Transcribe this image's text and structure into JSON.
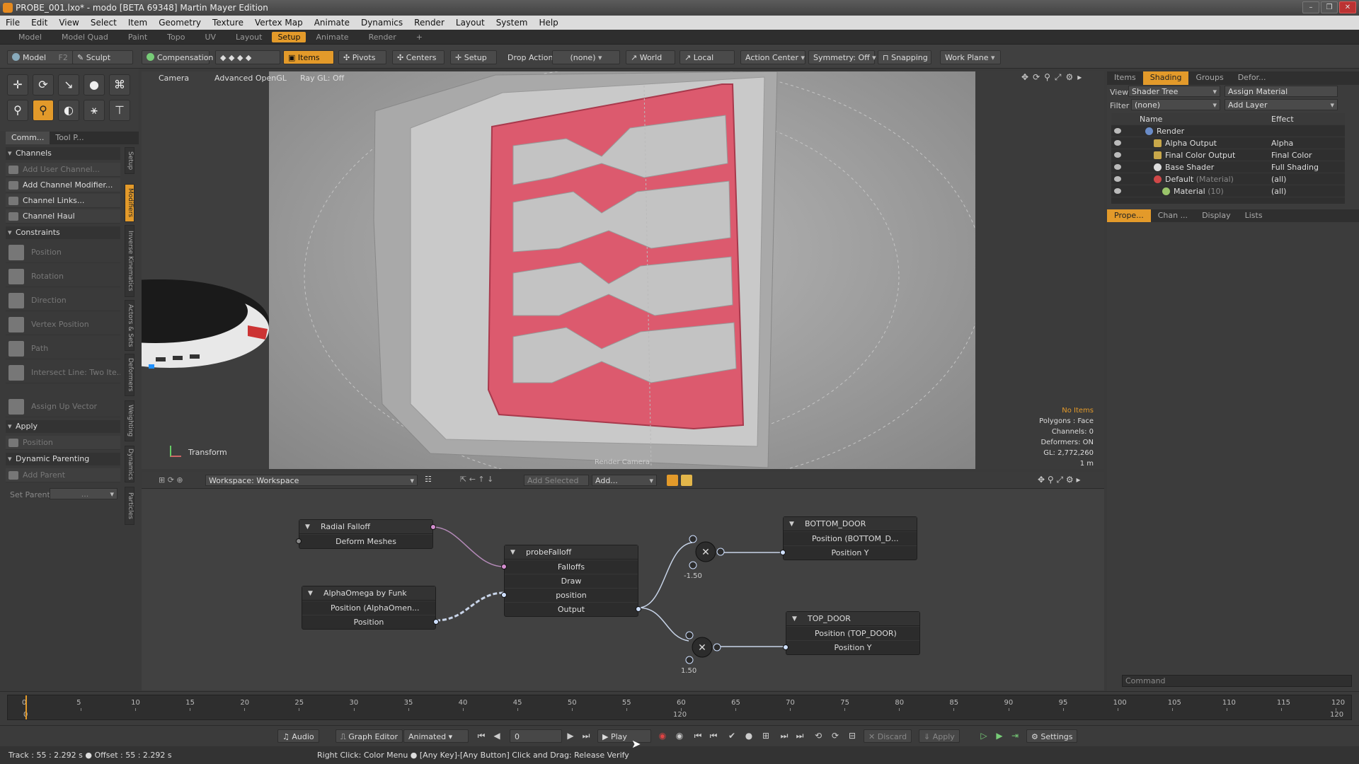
{
  "window": {
    "title": "PROBE_001.lxo* - modo [BETA 69348] Martin Mayer Edition",
    "buttons": [
      "–",
      "❐",
      "✕"
    ]
  },
  "menu": [
    "File",
    "Edit",
    "View",
    "Select",
    "Item",
    "Geometry",
    "Texture",
    "Vertex Map",
    "Animate",
    "Dynamics",
    "Render",
    "Layout",
    "System",
    "Help"
  ],
  "layout_tabs": [
    "Model",
    "Model Quad",
    "Paint",
    "Topo",
    "UV",
    "Layout",
    "Setup",
    "Animate",
    "Render",
    "+"
  ],
  "active_layout_tab": "Setup",
  "toolbar": {
    "model": "Model",
    "model_key": "F2",
    "sculpt": "Sculpt",
    "compensation": "Compensation",
    "items": "Items",
    "pivots": "Pivots",
    "centers": "Centers",
    "setup": "Setup",
    "drop_action_label": "Drop Action",
    "drop_action_value": "(none)",
    "world": "World",
    "local": "Local",
    "action_center": "Action Center",
    "symmetry": "Symmetry: Off",
    "snapping": "Snapping",
    "work_plane": "Work Plane"
  },
  "left_panel": {
    "tabs": [
      "Comm...",
      "Tool P..."
    ],
    "channels_header": "Channels",
    "channel_items": [
      "Add User Channel...",
      "Add Channel Modifier...",
      "Channel Links...",
      "Channel Haul"
    ],
    "constraints_header": "Constraints",
    "constraint_items": [
      "Position",
      "Rotation",
      "Direction",
      "Vertex Position",
      "Path",
      "Intersect Line: Two Ite...",
      "Assign Up Vector"
    ],
    "apply_header": "Apply",
    "apply_item": "Position",
    "dyn_header": "Dynamic Parenting",
    "dyn_item": "Add Parent",
    "set_parent_label": "Set Parent",
    "set_parent_value": "..."
  },
  "vertical_tabs": [
    "Setup",
    "Modifiers",
    "Inverse Kinematics",
    "Actors & Sets",
    "Deformers",
    "Weighting",
    "Dynamics",
    "Particles"
  ],
  "viewport": {
    "camera": "Camera",
    "shading": "Advanced OpenGL",
    "raygl": "Ray GL: Off",
    "transform_label": "Transform",
    "render_camera": "Render Camera",
    "stats": {
      "selection": "No Items",
      "polygons": "Polygons : Face",
      "channels": "Channels: 0",
      "deformers": "Deformers: ON",
      "gl": "GL: 2,772,260",
      "scale": "1 m"
    }
  },
  "node_editor": {
    "workspace": "Workspace: Workspace",
    "add_selected": "Add Selected",
    "add": "Add...",
    "nodes": {
      "radial": {
        "title": "Radial Falloff",
        "row": "Deform Meshes"
      },
      "alpha": {
        "title": "AlphaOmega by Funk",
        "sub": "Position (AlphaOmen...",
        "row": "Position"
      },
      "probe": {
        "title": "probeFalloff",
        "rows": [
          "Falloffs",
          "Draw",
          "position",
          "Output"
        ]
      },
      "bottom": {
        "title": "BOTTOM_DOOR",
        "sub": "Position (BOTTOM_D...",
        "row": "Position Y"
      },
      "top": {
        "title": "TOP_DOOR",
        "sub": "Position (TOP_DOOR)",
        "row": "Position Y"
      }
    },
    "mult_a_value": "-1.50",
    "mult_b_value": "1.50"
  },
  "right_panel": {
    "tabs": [
      "Items",
      "Shading",
      "Groups",
      "Defor..."
    ],
    "active_tab": "Shading",
    "view_label": "View",
    "view_value": "Shader Tree",
    "assign_material": "Assign Material",
    "filter_label": "Filter",
    "filter_value": "(none)",
    "add_layer": "Add Layer",
    "col_name": "Name",
    "col_effect": "Effect",
    "rows": [
      {
        "name": "Render",
        "effect": ""
      },
      {
        "name": "Alpha Output",
        "effect": "Alpha"
      },
      {
        "name": "Final Color Output",
        "effect": "Final Color"
      },
      {
        "name": "Base Shader",
        "effect": "Full Shading"
      },
      {
        "name": "Default",
        "tag": "(Material)",
        "effect": "(all)"
      },
      {
        "name": "Material",
        "tag": "(10)",
        "effect": "(all)"
      }
    ],
    "prop_tabs": [
      "Prope...",
      "Chan ...",
      "Display",
      "Lists"
    ],
    "command_placeholder": "Command"
  },
  "timeline": {
    "ticks": [
      "0",
      "5",
      "10",
      "15",
      "20",
      "25",
      "30",
      "35",
      "40",
      "45",
      "50",
      "55",
      "60",
      "65",
      "70",
      "75",
      "80",
      "85",
      "90",
      "95",
      "100",
      "105",
      "110",
      "115",
      "120"
    ],
    "start": "0",
    "mid": "120",
    "end": "120"
  },
  "transport": {
    "audio": "Audio",
    "graph_editor": "Graph Editor",
    "mode": "Animated",
    "frame": "0",
    "play": "Play",
    "discard": "Discard",
    "apply": "Apply",
    "settings": "Settings"
  },
  "status": {
    "left": "Track : 55 : 2.292 s ● Offset : 55 : 2.292 s",
    "hint": "Right Click: Color Menu ● [Any Key]-[Any Button] Click and Drag: Release Verify"
  },
  "colors": {
    "accent": "#e39a2a",
    "door": "#e0566c",
    "node_bg": "#2c2c2c"
  }
}
